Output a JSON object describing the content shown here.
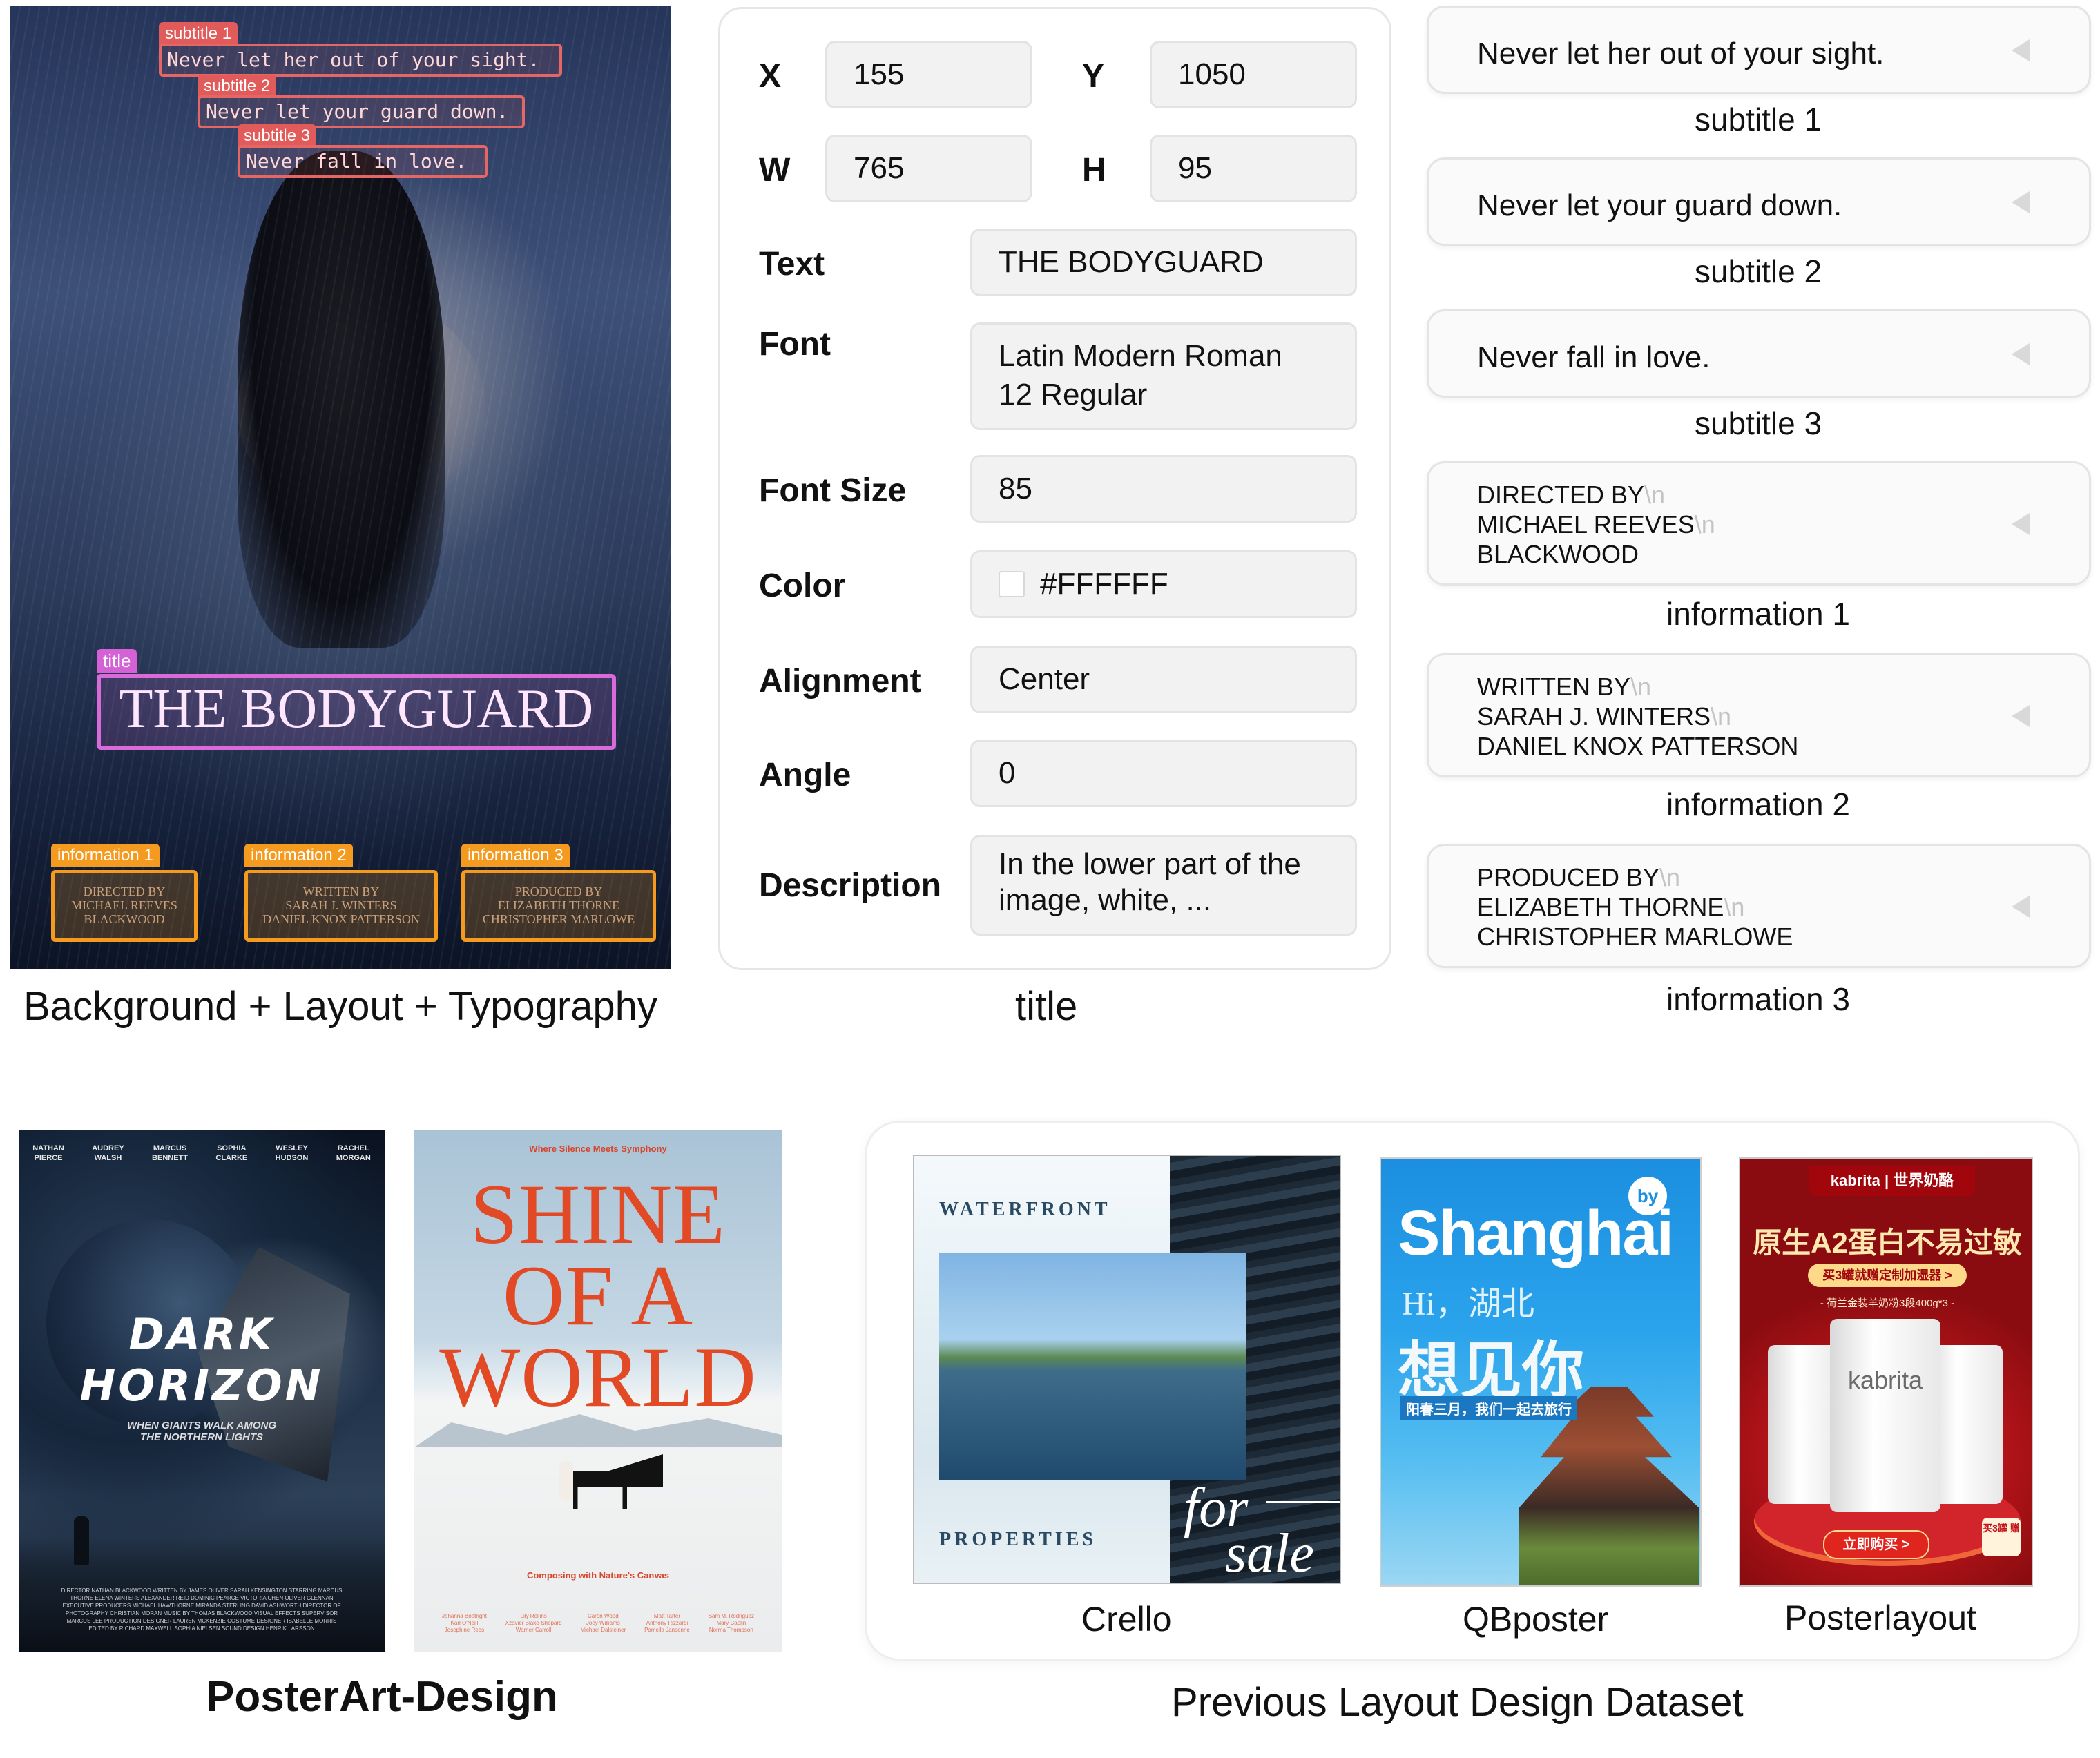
{
  "poster": {
    "labels": {
      "subtitle1": "subtitle 1",
      "subtitle2": "subtitle 2",
      "subtitle3": "subtitle 3",
      "title": "title",
      "information1": "information 1",
      "information2": "information 2",
      "information3": "information 3"
    },
    "subtitle1_text": "Never let her out of your sight.",
    "subtitle2_text": "Never let your guard down.",
    "subtitle3_text": "Never fall in love.",
    "title_text": "THE BODYGUARD",
    "info1_text": [
      "DIRECTED BY",
      "MICHAEL REEVES",
      "BLACKWOOD"
    ],
    "info2_text": [
      "WRITTEN BY",
      "SARAH J. WINTERS",
      "DANIEL KNOX PATTERSON"
    ],
    "info3_text": [
      "PRODUCED BY",
      "ELIZABETH THORNE",
      "CHRISTOPHER MARLOWE"
    ],
    "colors": {
      "subtitle": "#e66565",
      "title": "#d96ad9",
      "information": "#f39a1f"
    }
  },
  "captions": {
    "left": "Background + Layout + Typography",
    "middle": "title",
    "posterart": "PosterArt-Design",
    "previous": "Previous Layout Design  Dataset",
    "crello": "Crello",
    "qbposter": "QBposter",
    "posterlayout": "Posterlayout"
  },
  "panel": {
    "x_label": "X",
    "x_value": "155",
    "y_label": "Y",
    "y_value": "1050",
    "w_label": "W",
    "w_value": "765",
    "h_label": "H",
    "h_value": "95",
    "text_label": "Text",
    "text_value": "THE BODYGUARD",
    "font_label": "Font",
    "font_value_line1": "Latin Modern Roman",
    "font_value_line2": "12 Regular",
    "fontsize_label": "Font Size",
    "fontsize_value": "85",
    "color_label": "Color",
    "color_value": "#FFFFFF",
    "alignment_label": "Alignment",
    "alignment_value": "Center",
    "angle_label": "Angle",
    "angle_value": "0",
    "description_label": "Description",
    "description_line1": "In the lower part of the",
    "description_line2": "image, white, ..."
  },
  "elements_list": {
    "nl": "\\n",
    "items": [
      {
        "lines": [
          "Never let her out of your sight."
        ],
        "caption": "subtitle 1"
      },
      {
        "lines": [
          "Never let your guard down."
        ],
        "caption": "subtitle 2"
      },
      {
        "lines": [
          "Never fall in love."
        ],
        "caption": "subtitle 3"
      },
      {
        "lines": [
          "DIRECTED BY",
          "MICHAEL REEVES",
          "BLACKWOOD"
        ],
        "caption": "information 1"
      },
      {
        "lines": [
          "WRITTEN BY",
          "SARAH J. WINTERS",
          "DANIEL KNOX PATTERSON"
        ],
        "caption": "information 2"
      },
      {
        "lines": [
          "PRODUCED BY",
          "ELIZABETH THORNE",
          "CHRISTOPHER MARLOWE"
        ],
        "caption": "information 3"
      }
    ]
  },
  "dark_horizon": {
    "cast": [
      [
        "NATHAN",
        "PIERCE"
      ],
      [
        "AUDREY",
        "WALSH"
      ],
      [
        "MARCUS",
        "BENNETT"
      ],
      [
        "SOPHIA",
        "CLARKE"
      ],
      [
        "WESLEY",
        "HUDSON"
      ],
      [
        "RACHEL",
        "MORGAN"
      ]
    ],
    "title_line1": "DARK",
    "title_line2": "HORIZON",
    "tagline_line1": "WHEN GIANTS WALK AMONG",
    "tagline_line2": "THE NORTHERN LIGHTS",
    "credits": "DIRECTOR NATHAN BLACKWOOD WRITTEN BY JAMES OLIVER SARAH KENSINGTON STARRING MARCUS THORNE ELENA WINTERS ALEXANDER REID DOMINIC PEARCE VICTORIA CHEN OLIVER GLENNAN EXECUTIVE PRODUCERS MICHAEL HAWTHORNE MIRANDA STERLING DAVID ASHWORTH DIRECTOR OF PHOTOGRAPHY CHRISTIAN MORAN MUSIC BY THOMAS BLACKWOOD VISUAL EFFECTS SUPERVISOR MARCUS LEE PRODUCTION DESIGNER LAUREN MCKENZIE COSTUME DESIGNER ISABELLE MORRIS EDITED BY RICHARD MAXWELL SOPHIA NIELSEN SOUND DESIGN HENRIK LARSSON"
  },
  "shine": {
    "top_line": "Where Silence Meets Symphony",
    "title_line1": "SHINE",
    "title_line2": "OF A",
    "title_line3": "WORLD",
    "subline": "Composing with Nature's Canvas",
    "credits": [
      [
        "Johanna Boatright",
        "Karl O'Neill",
        "Josephine Rees"
      ],
      [
        "Lily Rollins",
        "Xzavier Blake-Shepard",
        "Warner Carroll"
      ],
      [
        "Caron Wood",
        "Joey Williams",
        "Michael Dalsteiner"
      ],
      [
        "Matt Tarter",
        "Anthony Rizzardi",
        "Pamella Jansenne"
      ],
      [
        "Sam M. Rodriguez",
        "Mary Caplin",
        "Norma Thompson"
      ]
    ]
  },
  "crello": {
    "line1": "WATERFRONT",
    "line2": "PROPERTIES",
    "for": "for",
    "sale": "sale"
  },
  "qbposter": {
    "title": "Shanghai",
    "badge": "by",
    "hi": "Hi，湖北",
    "big": "想见你",
    "sub": "阳春三月，我们一起去旅行"
  },
  "posterlayout": {
    "logo": "kabrita | 世界奶酪",
    "title": "原生A2蛋白不易过敏",
    "pill": "买3罐就赠定制加湿器 >",
    "sub": "- 荷兰金装羊奶粉3段400g*3 -",
    "can_brand": "kabrita",
    "button": "立即购买 >",
    "gift": "买3罐 赠"
  }
}
